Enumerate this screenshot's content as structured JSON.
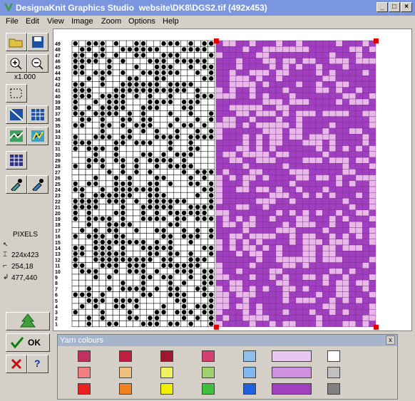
{
  "window": {
    "title": "DesignaKnit Graphics Studio  website\\DK8\\DGS2.tif (492x453)",
    "controls": [
      "_",
      "□",
      "×"
    ]
  },
  "menu": [
    "File",
    "Edit",
    "View",
    "Image",
    "Zoom",
    "Options",
    "Help"
  ],
  "sidebar": {
    "zoom_label": "x1.000",
    "units_label": "PIXELS",
    "size_readout": "224x423",
    "cursor_readout": "254,18",
    "position_readout": "477,440",
    "ok_label": "OK",
    "help_label": "?"
  },
  "grid": {
    "row_labels": [
      "49",
      "48",
      "47",
      "46",
      "45",
      "44",
      "43",
      "42",
      "41",
      "40",
      "39",
      "38",
      "37",
      "36",
      "35",
      "34",
      "33",
      "32",
      "31",
      "30",
      "29",
      "28",
      "27",
      "26",
      "25",
      "24",
      "23",
      "22",
      "21",
      "20",
      "19",
      "18",
      "17",
      "16",
      "15",
      "14",
      "13",
      "12",
      "11",
      "10",
      "9",
      "8",
      "7",
      "6",
      "5",
      "4",
      "3",
      "2",
      "1"
    ],
    "cols": 21,
    "colors": {
      "stitch_dark": "#000000",
      "grid_line": "#000000",
      "purple": "#a040c0",
      "light_purple": "#e8b8e8",
      "handle": "#e00000"
    }
  },
  "yarn_panel": {
    "title": "Yarn colours",
    "close": "x",
    "swatches_row1": [
      "#c03060",
      "#c02040",
      "#a01830",
      "#d04070",
      "#90c0e8",
      "#e8c8f0",
      "#ffffff"
    ],
    "swatches_row2": [
      "#f08080",
      "#f0c080",
      "#f0f060",
      "#a0d070",
      "#80b8f0",
      "#d090e0",
      "#c0c0c0"
    ],
    "swatches_row3": [
      "#e82020",
      "#f08020",
      "#f0f000",
      "#40c040",
      "#2060e0",
      "#a040c0",
      "#808080"
    ]
  }
}
